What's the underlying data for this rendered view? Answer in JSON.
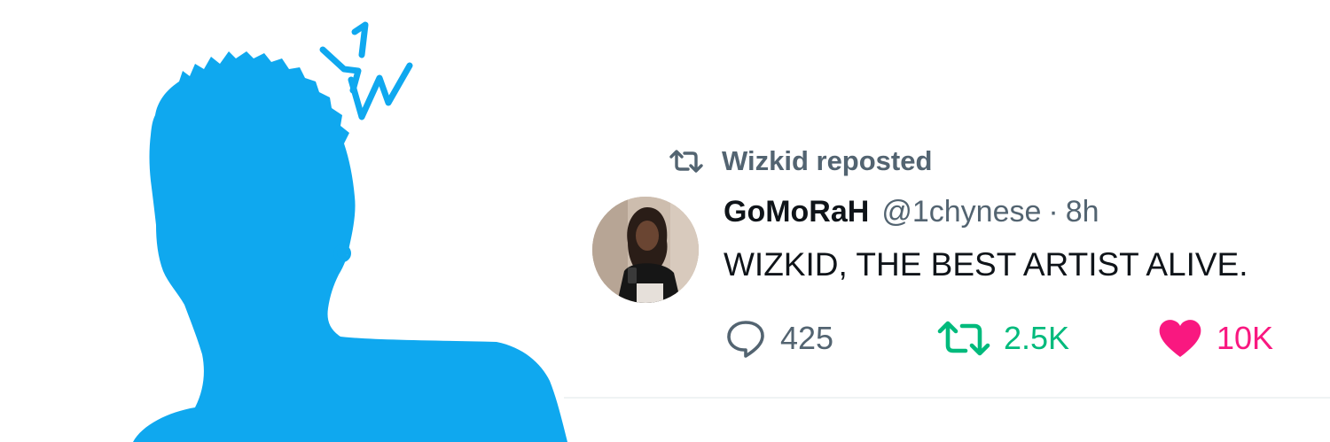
{
  "header": {
    "reposted_by": "Wizkid reposted",
    "repost_icon": "repost-icon"
  },
  "tweet": {
    "avatar": "user-avatar-photo",
    "display_name": "GoMoRaH",
    "handle": "@1chynese",
    "separator": "·",
    "time": "8h",
    "text": "WIZKID, THE BEST ARTIST ALIVE."
  },
  "actions": {
    "reply": {
      "icon": "reply-icon",
      "count": "425",
      "color": "#536471"
    },
    "retweet": {
      "icon": "retweet-icon",
      "count": "2.5K",
      "color": "#00ba7c"
    },
    "like": {
      "icon": "heart-icon",
      "count": "10K",
      "color": "#f91880"
    }
  },
  "colors": {
    "silhouette": "#0fa8ef",
    "text_primary": "#0f1419",
    "text_secondary": "#536471"
  }
}
